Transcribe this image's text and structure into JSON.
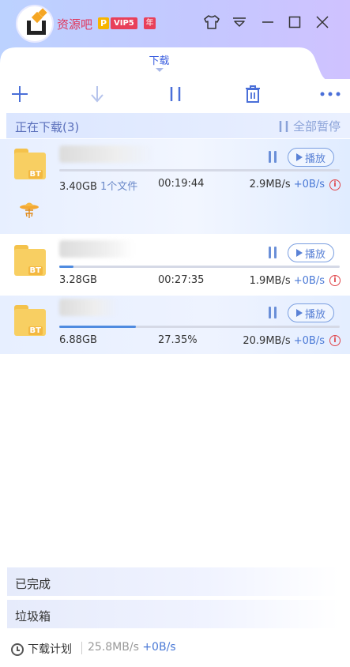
{
  "header": {
    "username": "资源吧",
    "badge_p": "P",
    "badge_vip": "VIP5",
    "badge_year": "年"
  },
  "tab": {
    "label": "下载"
  },
  "section": {
    "title": "正在下载(3)",
    "pause_all": "全部暂停"
  },
  "downloads": [
    {
      "size": "3.40GB",
      "files": "1个文件",
      "middle": "00:19:44",
      "down_speed": "2.9MB/s",
      "up_speed": "+0B/s",
      "progress": 0.0,
      "play_label": "播放",
      "info": "i"
    },
    {
      "size": "3.28GB",
      "middle": "00:27:35",
      "down_speed": "1.9MB/s",
      "up_speed": "+0B/s",
      "progress": 0.05,
      "play_label": "播放",
      "info": "i"
    },
    {
      "size": "6.88GB",
      "middle": "27.35%",
      "down_speed": "20.9MB/s",
      "up_speed": "+0B/s",
      "progress": 0.2735,
      "play_label": "播放",
      "info": "i"
    }
  ],
  "bottom": {
    "completed": "已完成",
    "trash": "垃圾箱"
  },
  "footer": {
    "plan": "下载计划",
    "down_speed": "25.8MB/s",
    "up_speed": "+0B/s"
  },
  "colors": {
    "accent": "#4f8be0",
    "vip": "#e8405a",
    "folder": "#f8cf62"
  }
}
